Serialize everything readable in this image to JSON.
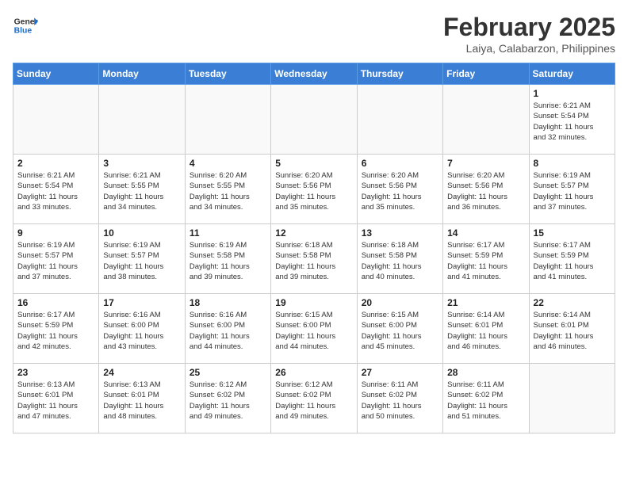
{
  "header": {
    "logo_general": "General",
    "logo_blue": "Blue",
    "month_year": "February 2025",
    "location": "Laiya, Calabarzon, Philippines"
  },
  "days_of_week": [
    "Sunday",
    "Monday",
    "Tuesday",
    "Wednesday",
    "Thursday",
    "Friday",
    "Saturday"
  ],
  "weeks": [
    [
      {
        "day": "",
        "info": ""
      },
      {
        "day": "",
        "info": ""
      },
      {
        "day": "",
        "info": ""
      },
      {
        "day": "",
        "info": ""
      },
      {
        "day": "",
        "info": ""
      },
      {
        "day": "",
        "info": ""
      },
      {
        "day": "1",
        "info": "Sunrise: 6:21 AM\nSunset: 5:54 PM\nDaylight: 11 hours\nand 32 minutes."
      }
    ],
    [
      {
        "day": "2",
        "info": "Sunrise: 6:21 AM\nSunset: 5:54 PM\nDaylight: 11 hours\nand 33 minutes."
      },
      {
        "day": "3",
        "info": "Sunrise: 6:21 AM\nSunset: 5:55 PM\nDaylight: 11 hours\nand 34 minutes."
      },
      {
        "day": "4",
        "info": "Sunrise: 6:20 AM\nSunset: 5:55 PM\nDaylight: 11 hours\nand 34 minutes."
      },
      {
        "day": "5",
        "info": "Sunrise: 6:20 AM\nSunset: 5:56 PM\nDaylight: 11 hours\nand 35 minutes."
      },
      {
        "day": "6",
        "info": "Sunrise: 6:20 AM\nSunset: 5:56 PM\nDaylight: 11 hours\nand 35 minutes."
      },
      {
        "day": "7",
        "info": "Sunrise: 6:20 AM\nSunset: 5:56 PM\nDaylight: 11 hours\nand 36 minutes."
      },
      {
        "day": "8",
        "info": "Sunrise: 6:19 AM\nSunset: 5:57 PM\nDaylight: 11 hours\nand 37 minutes."
      }
    ],
    [
      {
        "day": "9",
        "info": "Sunrise: 6:19 AM\nSunset: 5:57 PM\nDaylight: 11 hours\nand 37 minutes."
      },
      {
        "day": "10",
        "info": "Sunrise: 6:19 AM\nSunset: 5:57 PM\nDaylight: 11 hours\nand 38 minutes."
      },
      {
        "day": "11",
        "info": "Sunrise: 6:19 AM\nSunset: 5:58 PM\nDaylight: 11 hours\nand 39 minutes."
      },
      {
        "day": "12",
        "info": "Sunrise: 6:18 AM\nSunset: 5:58 PM\nDaylight: 11 hours\nand 39 minutes."
      },
      {
        "day": "13",
        "info": "Sunrise: 6:18 AM\nSunset: 5:58 PM\nDaylight: 11 hours\nand 40 minutes."
      },
      {
        "day": "14",
        "info": "Sunrise: 6:17 AM\nSunset: 5:59 PM\nDaylight: 11 hours\nand 41 minutes."
      },
      {
        "day": "15",
        "info": "Sunrise: 6:17 AM\nSunset: 5:59 PM\nDaylight: 11 hours\nand 41 minutes."
      }
    ],
    [
      {
        "day": "16",
        "info": "Sunrise: 6:17 AM\nSunset: 5:59 PM\nDaylight: 11 hours\nand 42 minutes."
      },
      {
        "day": "17",
        "info": "Sunrise: 6:16 AM\nSunset: 6:00 PM\nDaylight: 11 hours\nand 43 minutes."
      },
      {
        "day": "18",
        "info": "Sunrise: 6:16 AM\nSunset: 6:00 PM\nDaylight: 11 hours\nand 44 minutes."
      },
      {
        "day": "19",
        "info": "Sunrise: 6:15 AM\nSunset: 6:00 PM\nDaylight: 11 hours\nand 44 minutes."
      },
      {
        "day": "20",
        "info": "Sunrise: 6:15 AM\nSunset: 6:00 PM\nDaylight: 11 hours\nand 45 minutes."
      },
      {
        "day": "21",
        "info": "Sunrise: 6:14 AM\nSunset: 6:01 PM\nDaylight: 11 hours\nand 46 minutes."
      },
      {
        "day": "22",
        "info": "Sunrise: 6:14 AM\nSunset: 6:01 PM\nDaylight: 11 hours\nand 46 minutes."
      }
    ],
    [
      {
        "day": "23",
        "info": "Sunrise: 6:13 AM\nSunset: 6:01 PM\nDaylight: 11 hours\nand 47 minutes."
      },
      {
        "day": "24",
        "info": "Sunrise: 6:13 AM\nSunset: 6:01 PM\nDaylight: 11 hours\nand 48 minutes."
      },
      {
        "day": "25",
        "info": "Sunrise: 6:12 AM\nSunset: 6:02 PM\nDaylight: 11 hours\nand 49 minutes."
      },
      {
        "day": "26",
        "info": "Sunrise: 6:12 AM\nSunset: 6:02 PM\nDaylight: 11 hours\nand 49 minutes."
      },
      {
        "day": "27",
        "info": "Sunrise: 6:11 AM\nSunset: 6:02 PM\nDaylight: 11 hours\nand 50 minutes."
      },
      {
        "day": "28",
        "info": "Sunrise: 6:11 AM\nSunset: 6:02 PM\nDaylight: 11 hours\nand 51 minutes."
      },
      {
        "day": "",
        "info": ""
      }
    ]
  ]
}
